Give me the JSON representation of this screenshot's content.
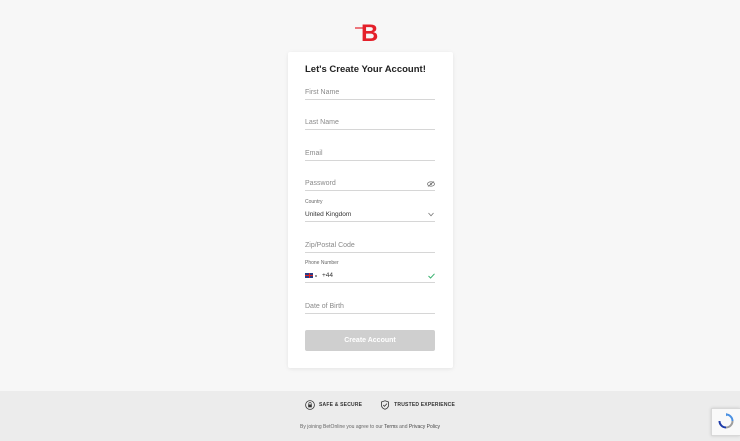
{
  "brand": {
    "logo_letter": "B",
    "color": "#e4202a"
  },
  "form": {
    "title": "Let's Create Your Account!",
    "first_name": {
      "placeholder": "First Name"
    },
    "last_name": {
      "placeholder": "Last Name"
    },
    "email": {
      "placeholder": "Email"
    },
    "password": {
      "placeholder": "Password"
    },
    "country": {
      "label": "Country",
      "value": "United Kingdom"
    },
    "zip": {
      "placeholder": "Zip/Postal Code"
    },
    "phone": {
      "label": "Phone Number",
      "dial_code": "+44"
    },
    "dob": {
      "placeholder": "Date of Birth"
    },
    "submit_label": "Create Account"
  },
  "footer": {
    "badges": [
      "SAFE & SECURE",
      "TRUSTED EXPERIENCE"
    ],
    "legal_prefix": "By joining BetOnline you agree to our ",
    "terms_label": "Terms",
    "and": " and ",
    "privacy_label": "Privacy Policy"
  },
  "colors": {
    "check": "#3cb371",
    "button_disabled": "#cfcfcf",
    "footer_bg": "#ececec"
  }
}
